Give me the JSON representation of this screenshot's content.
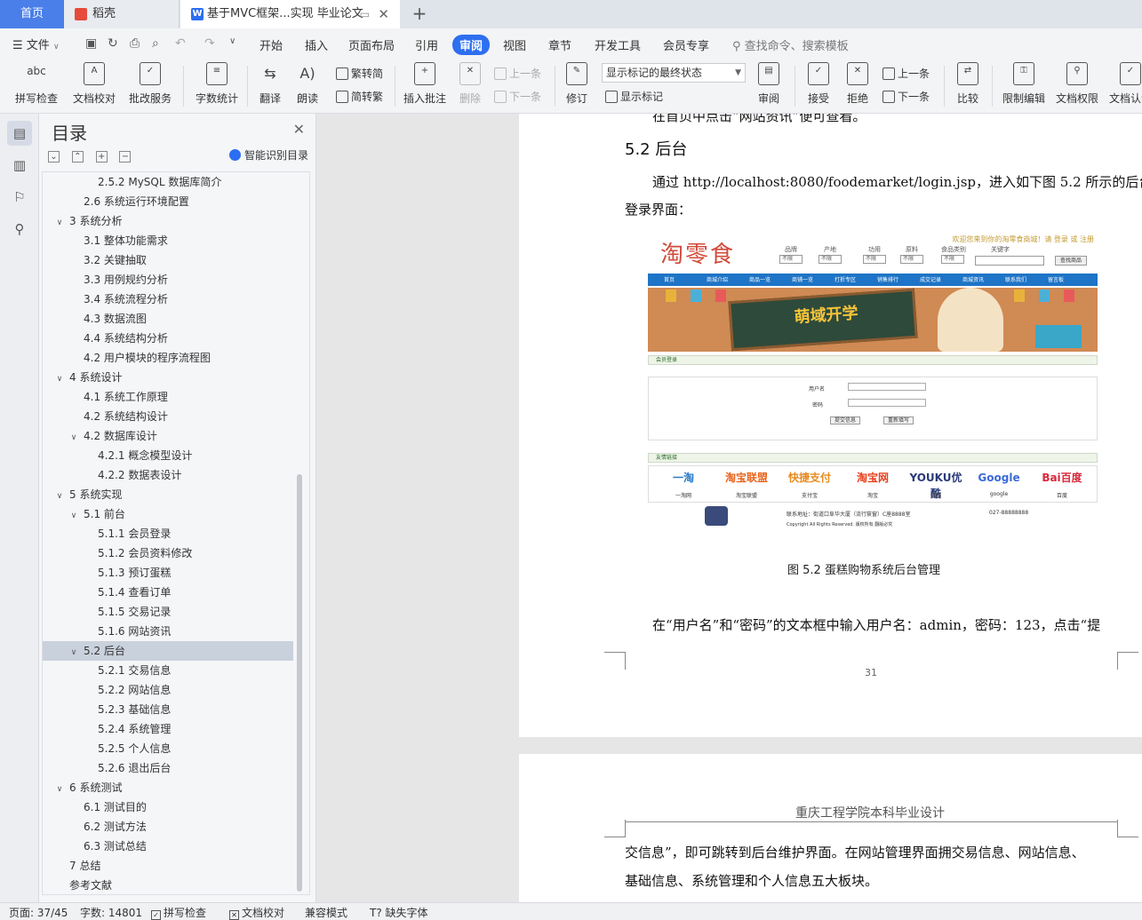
{
  "tabs": {
    "home": "首页",
    "docer": "稻壳",
    "doc": "基于MVC框架...实现 毕业论文",
    "doc_icon": "W"
  },
  "menu": {
    "file": "文件",
    "items": [
      "开始",
      "插入",
      "页面布局",
      "引用",
      "审阅",
      "视图",
      "章节",
      "开发工具",
      "会员专享"
    ],
    "active": "审阅",
    "search": "查找命令、搜索模板"
  },
  "ribbon": {
    "spell": "拼写检查",
    "proofread": "文档校对",
    "annotate_service": "批改服务",
    "word_count": "字数统计",
    "translate": "翻译",
    "read_aloud": "朗读",
    "trad_to_simp": "繁转简",
    "simp_to_trad": "简转繁",
    "insert_comment": "插入批注",
    "delete": "删除",
    "prev": "上一条",
    "next": "下一条",
    "revise": "修订",
    "markup_state": "显示标记的最终状态",
    "show_markup": "显示标记",
    "review": "审阅",
    "accept": "接受",
    "reject": "拒绝",
    "prev2": "上一条",
    "next2": "下一条",
    "compare": "比较",
    "restrict_edit": "限制编辑",
    "doc_permission": "文档权限",
    "doc_auth": "文档认证"
  },
  "nav": {
    "title": "目录",
    "smart": "智能识别目录",
    "toc": [
      {
        "text": "2.5.2 MySQL 数据库简介",
        "level": 3,
        "chev": ""
      },
      {
        "text": "2.6  系统运行环境配置",
        "level": 2,
        "chev": ""
      },
      {
        "text": "3  系统分析",
        "level": 1,
        "chev": "v"
      },
      {
        "text": "3.1  整体功能需求",
        "level": 2,
        "chev": ""
      },
      {
        "text": "3.2  关键抽取",
        "level": 2,
        "chev": ""
      },
      {
        "text": "3.3  用例规约分析",
        "level": 2,
        "chev": ""
      },
      {
        "text": "3.4  系统流程分析",
        "level": 2,
        "chev": ""
      },
      {
        "text": "4.3  数据流图",
        "level": 2,
        "chev": ""
      },
      {
        "text": "4.4  系统结构分析",
        "level": 2,
        "chev": ""
      },
      {
        "text": "4.2  用户模块的程序流程图",
        "level": 2,
        "chev": ""
      },
      {
        "text": "4  系统设计",
        "level": 1,
        "chev": "v"
      },
      {
        "text": "4.1  系统工作原理",
        "level": 2,
        "chev": ""
      },
      {
        "text": "4.2  系统结构设计",
        "level": 2,
        "chev": ""
      },
      {
        "text": "4.2 数据库设计",
        "level": 2,
        "chev": "v"
      },
      {
        "text": "4.2.1  概念模型设计",
        "level": 3,
        "chev": ""
      },
      {
        "text": "4.2.2  数据表设计",
        "level": 3,
        "chev": ""
      },
      {
        "text": "5  系统实现",
        "level": 1,
        "chev": "v"
      },
      {
        "text": "5.1  前台",
        "level": 2,
        "chev": "v"
      },
      {
        "text": "5.1.1  会员登录",
        "level": 3,
        "chev": ""
      },
      {
        "text": "5.1.2  会员资料修改",
        "level": 3,
        "chev": ""
      },
      {
        "text": "5.1.3  预订蛋糕",
        "level": 3,
        "chev": ""
      },
      {
        "text": "5.1.4  查看订单",
        "level": 3,
        "chev": ""
      },
      {
        "text": "5.1.5  交易记录",
        "level": 3,
        "chev": ""
      },
      {
        "text": "5.1.6  网站资讯",
        "level": 3,
        "chev": ""
      },
      {
        "text": "5.2  后台",
        "level": 2,
        "chev": "v",
        "selected": true
      },
      {
        "text": "5.2.1  交易信息",
        "level": 3,
        "chev": ""
      },
      {
        "text": "5.2.2  网站信息",
        "level": 3,
        "chev": ""
      },
      {
        "text": "5.2.3  基础信息",
        "level": 3,
        "chev": ""
      },
      {
        "text": "5.2.4  系统管理",
        "level": 3,
        "chev": ""
      },
      {
        "text": "5.2.5  个人信息",
        "level": 3,
        "chev": ""
      },
      {
        "text": "5.2.6  退出后台",
        "level": 3,
        "chev": ""
      },
      {
        "text": "6  系统测试",
        "level": 1,
        "chev": "v"
      },
      {
        "text": "6.1  测试目的",
        "level": 2,
        "chev": ""
      },
      {
        "text": "6.2  测试方法",
        "level": 2,
        "chev": ""
      },
      {
        "text": "6.3  测试总结",
        "level": 2,
        "chev": ""
      },
      {
        "text": "7  总结",
        "level": 1,
        "chev": ""
      },
      {
        "text": "参考文献",
        "level": 1,
        "chev": ""
      }
    ]
  },
  "doc": {
    "top_cut_line": "在首页中点击“网站资讯”便可查看。",
    "heading": "5.2  后台",
    "para1_line1": "通过 http://localhost:8080/foodemarket/login.jsp，进入如下图 5.2  所示的后台",
    "para1_line2": "登录界面：",
    "caption": "图 5.2    蛋糕购物系统后台管理",
    "para2_line1": "在“用户名”和“密码”的文本框中输入用户名：admin，密码：123，点击“提",
    "page_number": "31",
    "page2_header": "重庆工程学院本科毕业设计",
    "page2_line1": "交信息”，即可跳转到后台维护界面。在网站管理界面拥交易信息、网站信息、",
    "page2_line2": "基础信息、系统管理和个人信息五大板块。"
  },
  "screenshot": {
    "logo": "淘零食",
    "welcome": "欢迎您来到你的淘零食商城！请 登录 或 注册",
    "filters": [
      {
        "label": "品牌",
        "value": "不限"
      },
      {
        "label": "产地",
        "value": "不限"
      },
      {
        "label": "功用",
        "value": "不限"
      },
      {
        "label": "原料",
        "value": "不限"
      },
      {
        "label": "食品类别",
        "value": "不限"
      }
    ],
    "keyword_label": "关键字",
    "search_btn": "查找商品",
    "nav": [
      "首页",
      "商城介绍",
      "商品一览",
      "商铺一览",
      "打折专区",
      "销售排行",
      "成交记录",
      "商城资讯",
      "联系我们",
      "留言板"
    ],
    "banner_text": "萌域开学",
    "member_login": "会员登录",
    "username_label": "用户名",
    "password_label": "密码",
    "submit_btn": "提交信息",
    "reset_btn": "重新填写",
    "friend_links": "友情链接",
    "links": [
      {
        "logo": "一淘",
        "caption": "一淘网",
        "color": "#2a7ac7"
      },
      {
        "logo": "淘宝联盟",
        "caption": "淘宝联盟",
        "color": "#e8641e"
      },
      {
        "logo": "快捷支付",
        "caption": "支付宝",
        "color": "#e88a1e"
      },
      {
        "logo": "淘宝网",
        "caption": "淘宝",
        "color": "#e8401e"
      },
      {
        "logo": "YOUKU优酷",
        "caption": "优酷",
        "color": "#2a3a7a"
      },
      {
        "logo": "Google",
        "caption": "google",
        "color": "#3a6ad8"
      },
      {
        "logo": "Bai百度",
        "caption": "百度",
        "color": "#d8283a"
      }
    ],
    "footer_addr": "联系地址：街道口阜华大厦（流行筱窗）C座8888室",
    "footer_tel": "027-88888888",
    "footer_copy": "Copyright All Rights Reserved.  版权所有    翻版必究"
  },
  "status": {
    "page": "页面: 37/45",
    "words": "字数: 14801",
    "spell": "拼写检查",
    "proof": "文档校对",
    "compat": "兼容模式",
    "missing_font": "缺失字体"
  },
  "colors": {
    "accent": "#2d6ff0",
    "home_tab": "#4a7ee8",
    "toc_selected": "#c9d1dc",
    "shot_nav": "#1e74c6"
  }
}
